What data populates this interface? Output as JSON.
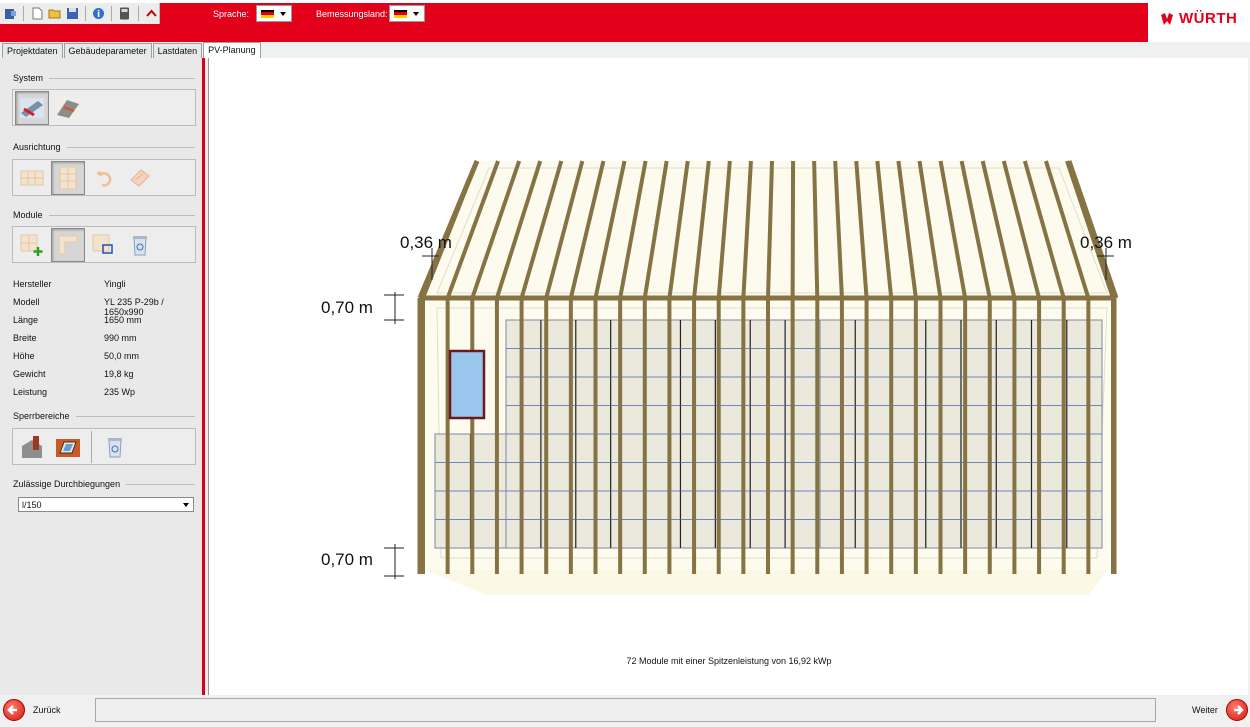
{
  "header": {
    "language_label": "Sprache:",
    "country_label": "Bemessungsland:",
    "logo_text": "WÜRTH",
    "accent_color": "#e2001a"
  },
  "toolbar": [
    "exit-icon",
    "new-file-icon",
    "open-folder-icon",
    "save-icon",
    "info-icon",
    "calculator-icon",
    "collapse-icon"
  ],
  "tabs": [
    {
      "label": "Projektdaten"
    },
    {
      "label": "Gebäudeparameter"
    },
    {
      "label": "Lastdaten"
    },
    {
      "label": "PV-Planung"
    }
  ],
  "left": {
    "system_label": "System",
    "orientation_label": "Ausrichtung",
    "module_label": "Module",
    "blocked_label": "Sperrbereiche",
    "deflection_label": "Zulässige Durchbiegungen",
    "deflection_value": "l/150",
    "props": [
      {
        "label": "Hersteller",
        "value": "Yingli"
      },
      {
        "label": "Modell",
        "value": "YL 235 P-29b / 1650x990"
      },
      {
        "label": "Länge",
        "value": "1650 mm"
      },
      {
        "label": "Breite",
        "value": "990 mm"
      },
      {
        "label": "Höhe",
        "value": "50,0 mm"
      },
      {
        "label": "Gewicht",
        "value": "19,8 kg"
      },
      {
        "label": "Leistung",
        "value": "235 Wp"
      }
    ]
  },
  "drawing": {
    "dim_left": "0,36 m",
    "dim_right": "0,36 m",
    "dim_top": "0,70 m",
    "dim_bottom": "0,70 m",
    "summary": "72 Module mit einer Spitzenleistung von 16,92 kWp"
  },
  "footer": {
    "back_label": "Zurück",
    "next_label": "Weiter"
  }
}
